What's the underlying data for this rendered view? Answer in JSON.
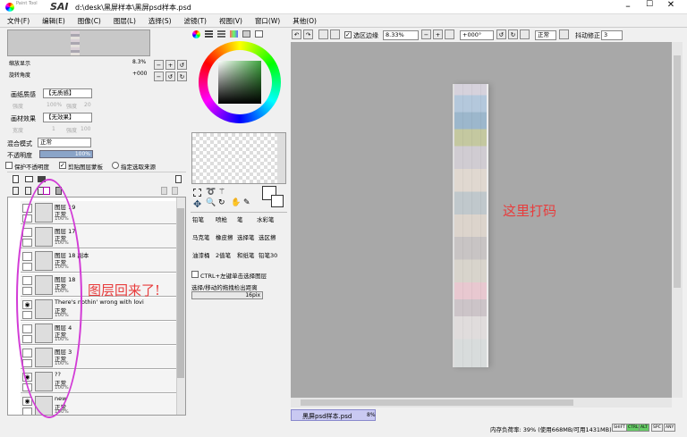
{
  "window": {
    "app_logo": "SAI",
    "logo_sub": "Paint Tool",
    "title": "d:\\desk\\黑屏样本\\黑屏psd样本.psd"
  },
  "menu": [
    "文件(F)",
    "编辑(E)",
    "图像(C)",
    "图层(L)",
    "选择(S)",
    "滤镜(T)",
    "视图(V)",
    "窗口(W)",
    "其他(O)"
  ],
  "navigator": {
    "zoom_label": "缩放显示",
    "zoom_value": "8.3%",
    "rotate_label": "旋转角度",
    "rotate_value": "+000"
  },
  "paper": {
    "texture_label": "画纸质感",
    "texture_value": "【无质感】",
    "scale_label": "强度",
    "scale_value": "100%",
    "strength_label": "强度",
    "strength_value": "20",
    "effect_label": "画材效果",
    "effect_value": "【无效果】",
    "width_label": "宽度",
    "width_value": "1",
    "edge_label": "强度",
    "edge_value": "100"
  },
  "blend": {
    "mode_label": "混合模式",
    "mode_value": "正常",
    "opacity_label": "不透明度",
    "opacity_value": "100%"
  },
  "checks": {
    "protect": "保护不透明度",
    "clip": "剪贴图层蒙板",
    "source": "指定选取来源"
  },
  "layers": [
    {
      "name": "图层 19",
      "mode": "正常",
      "opacity": "100%",
      "visible": false
    },
    {
      "name": "图层 17",
      "mode": "正常",
      "opacity": "100%",
      "visible": false
    },
    {
      "name": "图层 18 副本",
      "mode": "正常",
      "opacity": "100%",
      "visible": false
    },
    {
      "name": "图层 18",
      "mode": "正常",
      "opacity": "100%",
      "visible": false
    },
    {
      "name": "There's nothin' wrong with lovi",
      "mode": "正常",
      "opacity": "100%",
      "visible": true
    },
    {
      "name": "图层 4",
      "mode": "正常",
      "opacity": "100%",
      "visible": false
    },
    {
      "name": "图层 3",
      "mode": "正常",
      "opacity": "100%",
      "visible": false
    },
    {
      "name": "??",
      "mode": "正常",
      "opacity": "100%",
      "visible": true
    },
    {
      "name": "new",
      "mode": "正常",
      "opacity": "100%",
      "visible": true
    }
  ],
  "annotations": {
    "layers_back": "图层回来了!",
    "mosaic_here": "这里打码"
  },
  "tools": {
    "row1": [
      "铅笔",
      "喷枪",
      "笔",
      "水彩笔"
    ],
    "row2": [
      "马克笔",
      "橡皮擦",
      "选择笔",
      "选区擦"
    ],
    "row3": [
      "油漆桶",
      "2值笔",
      "和纸笔",
      "铅笔30"
    ]
  },
  "tool_options": {
    "ctrl_label": "CTRL+左键单击选择图层",
    "move_label": "选择/移动的拖拽检出距离",
    "move_value": "16pix"
  },
  "toolbar": {
    "stabilizer_check": "选区边缘",
    "zoom": "8.33%",
    "angle": "+000°",
    "mode": "正常",
    "correction_label": "抖动修正",
    "correction_value": "3"
  },
  "doc_tab": {
    "name": "黑屏psd样本.psd",
    "zoom": "8%"
  },
  "status": {
    "memory": "内存负荷率: 39% (使用668MB/可用1431MB)",
    "keys": [
      "SHIFT",
      "CTRL",
      "ALT",
      "SPC",
      "ANY"
    ]
  },
  "colors": {
    "annotation": "#e83c3c",
    "circle": "#d23bd6",
    "canvas_bg": "#a8a8a8"
  }
}
